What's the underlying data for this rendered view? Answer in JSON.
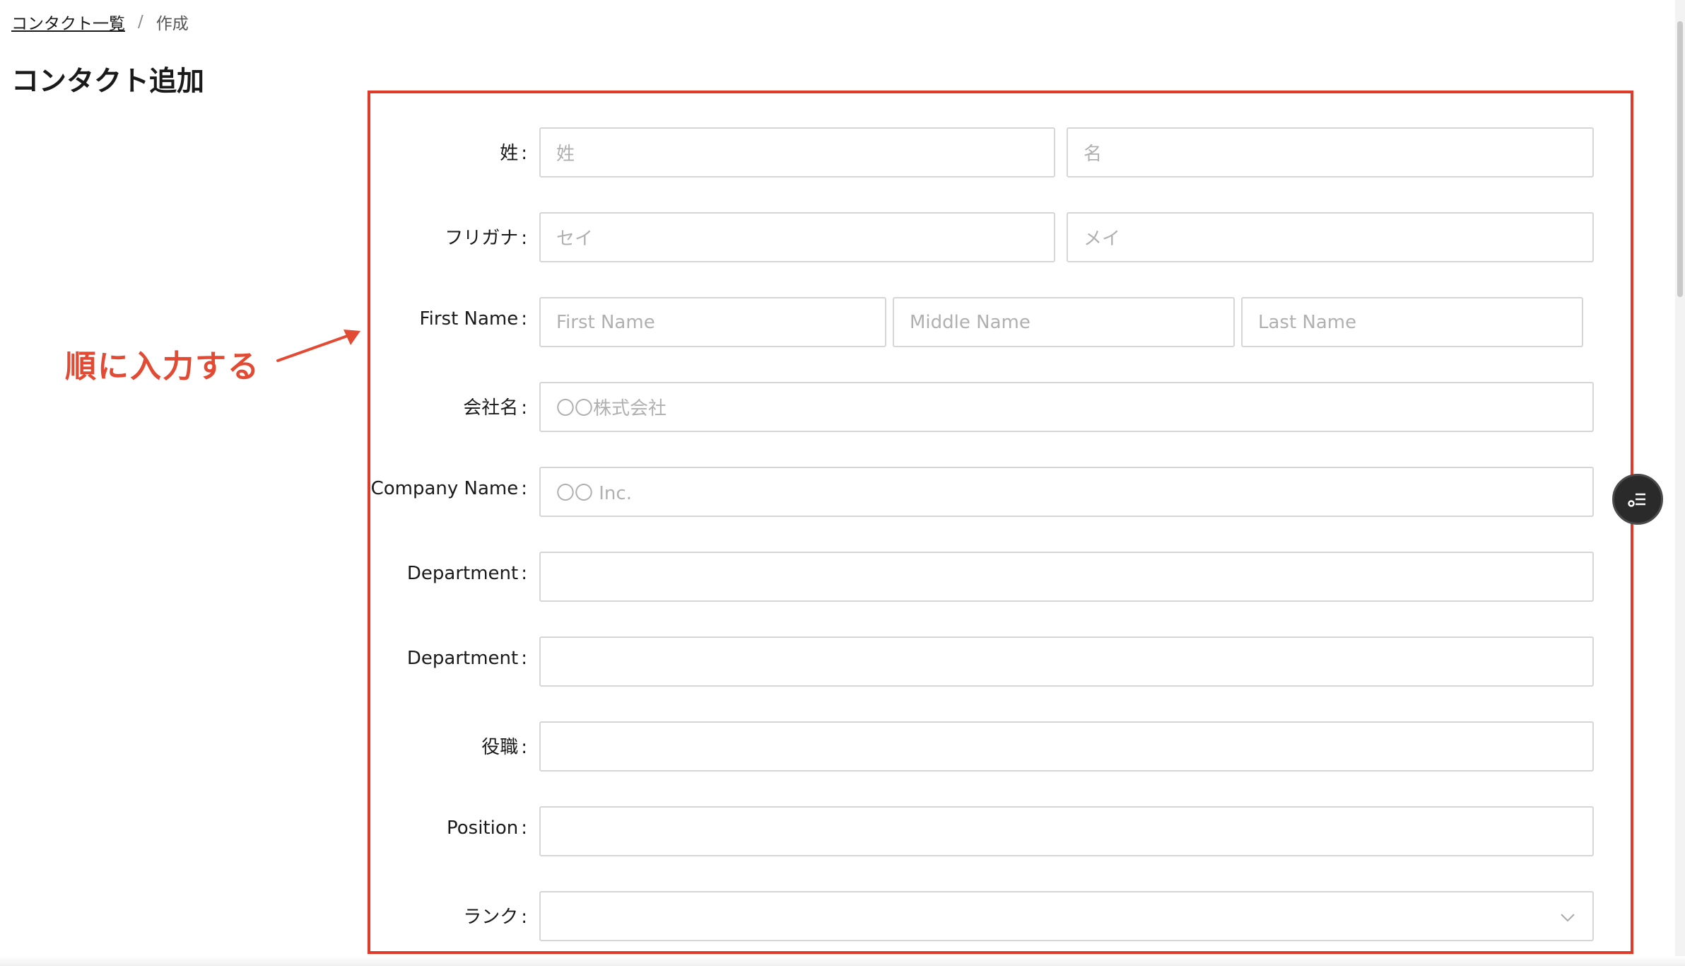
{
  "breadcrumb": {
    "parent": "コンタクト一覧",
    "separator": "/",
    "current": "作成"
  },
  "page_title": "コンタクト追加",
  "annotation": {
    "text": "順に入力する",
    "color": "#e34a33"
  },
  "highlight_color": "#e03a2a",
  "form": {
    "rows": [
      {
        "label": "姓",
        "fields": [
          {
            "placeholder": "姓"
          },
          {
            "placeholder": "名"
          }
        ]
      },
      {
        "label": "フリガナ",
        "fields": [
          {
            "placeholder": "セイ"
          },
          {
            "placeholder": "メイ"
          }
        ]
      },
      {
        "label": "First Name",
        "fields": [
          {
            "placeholder": "First Name"
          },
          {
            "placeholder": "Middle Name"
          },
          {
            "placeholder": "Last Name"
          }
        ]
      },
      {
        "label": "会社名",
        "fields": [
          {
            "placeholder": "〇〇株式会社"
          }
        ]
      },
      {
        "label": "Company Name",
        "fields": [
          {
            "placeholder": "〇〇 Inc."
          }
        ]
      },
      {
        "label": "Department",
        "fields": [
          {
            "placeholder": ""
          }
        ]
      },
      {
        "label": "Department",
        "fields": [
          {
            "placeholder": ""
          }
        ]
      },
      {
        "label": "役職",
        "fields": [
          {
            "placeholder": ""
          }
        ]
      },
      {
        "label": "Position",
        "fields": [
          {
            "placeholder": ""
          }
        ]
      },
      {
        "label": "ランク",
        "fields": [
          {
            "placeholder": "",
            "type": "select"
          }
        ]
      }
    ],
    "colon": ":"
  },
  "icons": {
    "select_chevron": "chevron-down-icon",
    "floating_button": "list-icon"
  }
}
